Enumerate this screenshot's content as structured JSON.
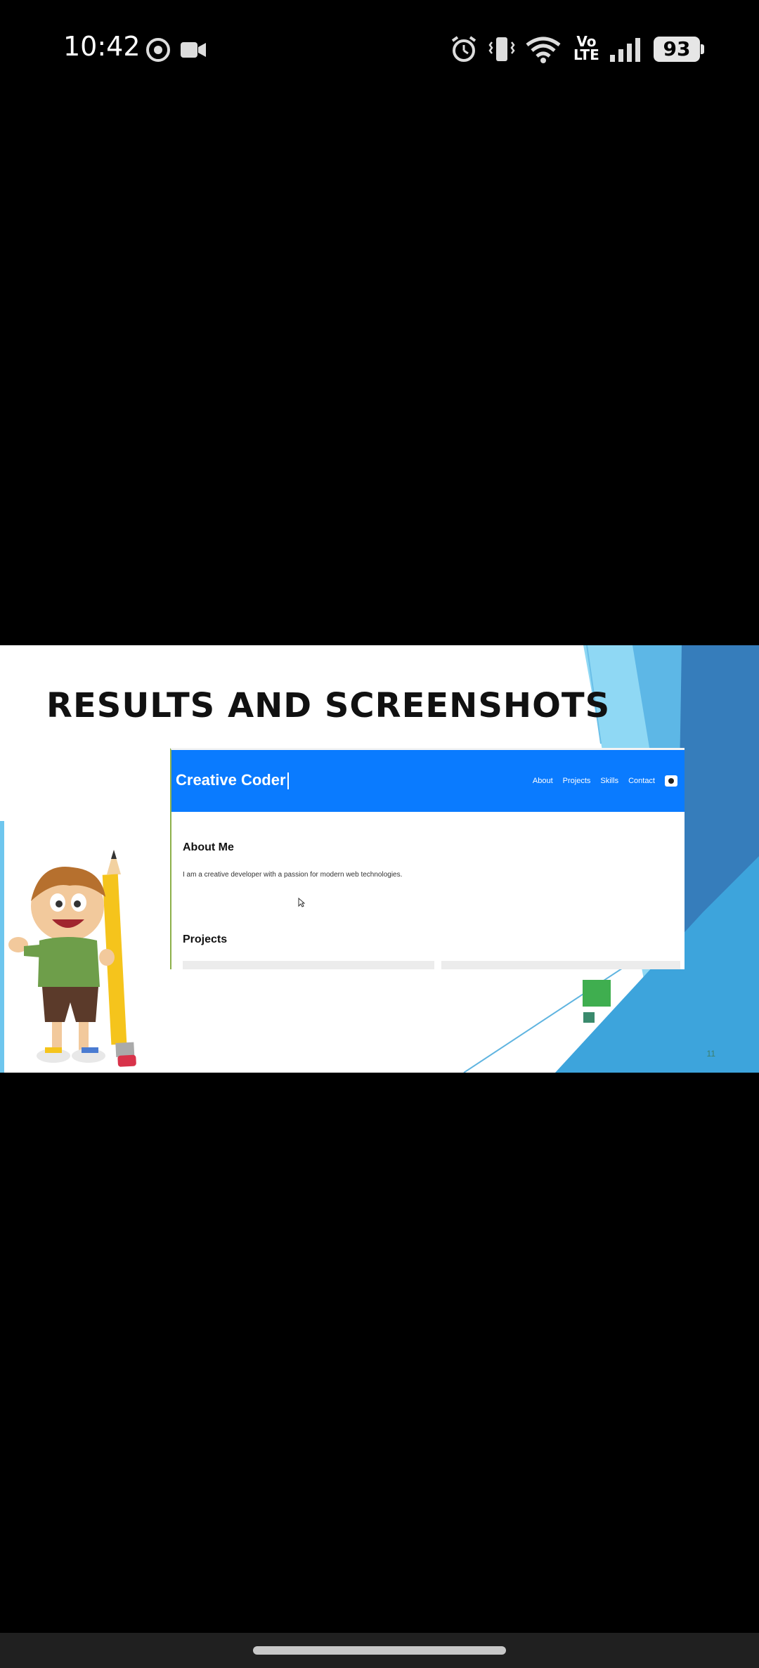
{
  "status_bar": {
    "time": "10:42",
    "battery": "93",
    "network_label": "Vo\nLTE",
    "icons": [
      "chrome-icon",
      "video-camera-icon",
      "alarm-icon",
      "vibrate-icon",
      "wifi-icon",
      "volte-icon",
      "signal-icon",
      "battery-icon"
    ]
  },
  "slide": {
    "title": "RESULTS AND SCREENSHOTS",
    "slide_number": "11",
    "screenshot": {
      "brand": "Creative Coder",
      "nav": [
        "About",
        "Projects",
        "Skills",
        "Contact"
      ],
      "about_heading": "About Me",
      "about_text": "I am a creative developer with a passion for modern web technologies.",
      "projects_heading": "Projects"
    },
    "colors": {
      "header_blue": "#0a7bff",
      "accent_green": "#3fae4f",
      "accent_teal": "#3a8a6d",
      "bg_blue_light": "#7fd1f2",
      "bg_blue_dark": "#2a6aa6"
    }
  }
}
